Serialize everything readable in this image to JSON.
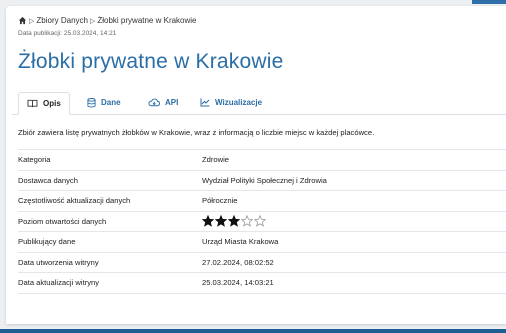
{
  "breadcrumb": {
    "home_icon": "home-icon",
    "items": [
      "Zbiory Danych",
      "Żłobki prywatne w Krakowie"
    ]
  },
  "publication": "Data publikacji: 25.03.2024, 14:21",
  "title": "Żłobki prywatne w Krakowie",
  "tabs": [
    {
      "label": "Opis",
      "icon": "book-icon",
      "active": true
    },
    {
      "label": "Dane",
      "icon": "database-icon",
      "active": false
    },
    {
      "label": "API",
      "icon": "cloud-icon",
      "active": false
    },
    {
      "label": "Wizualizacje",
      "icon": "chart-icon",
      "active": false
    }
  ],
  "description": "Zbiór zawiera listę prywatnych żłobków w Krakowie, wraz z informacją o liczbie miejsc w każdej placówce.",
  "details": [
    {
      "key": "Kategoria",
      "value": "Zdrowie"
    },
    {
      "key": "Dostawca danych",
      "value": "Wydział Polityki Społecznej i Zdrowia"
    },
    {
      "key": "Częstotliwość aktualizacji danych",
      "value": "Półrocznie"
    },
    {
      "key": "Poziom otwartości danych",
      "value": ""
    },
    {
      "key": "Publikujący dane",
      "value": "Urząd Miasta Krakowa"
    },
    {
      "key": "Data utworzenia witryny",
      "value": "27.02.2024, 08:02:52"
    },
    {
      "key": "Data aktualizacji witryny",
      "value": "25.03.2024, 14:03:21"
    }
  ],
  "openness_rating": {
    "filled": 3,
    "max": 5
  },
  "colors": {
    "accent": "#2b6ea6",
    "footer": "#1f5e93",
    "background": "#edf0f3"
  }
}
